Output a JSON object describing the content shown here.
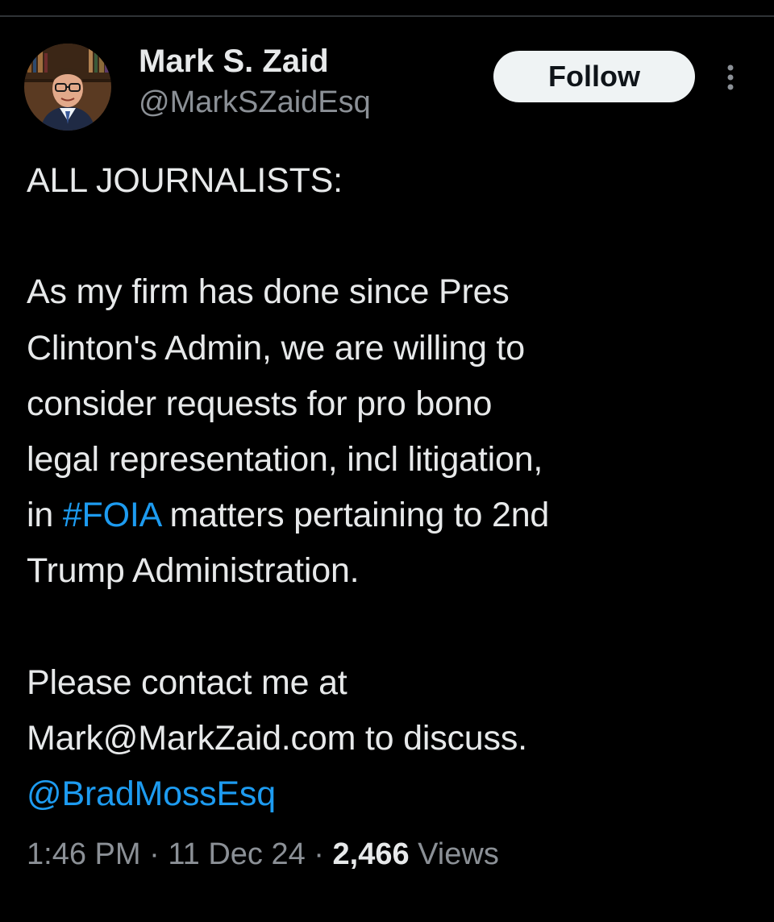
{
  "author": {
    "display_name": "Mark S. Zaid",
    "handle": "@MarkSZaidEsq"
  },
  "actions": {
    "follow_label": "Follow",
    "more_icon": "more-vertical-icon"
  },
  "tweet": {
    "line_1": "ALL JOURNALISTS:",
    "line_2": "As my firm has done since Pres",
    "line_3": "Clinton's Admin, we are willing to",
    "line_4": "consider requests for pro bono",
    "line_5": "legal representation, incl litigation,",
    "line_6_prefix": "in ",
    "hashtag": "#FOIA",
    "line_6_suffix": " matters pertaining to 2nd",
    "line_7": "Trump Administration.",
    "line_8": "Please contact me at",
    "line_9": "Mark@MarkZaid.com to discuss.",
    "mention": "@BradMossEsq"
  },
  "meta": {
    "time": "1:46 PM",
    "separator_1": " · ",
    "date": "11 Dec 24",
    "separator_2": " · ",
    "views_count": "2,466",
    "views_label": " Views"
  },
  "colors": {
    "background": "#000000",
    "text": "#e7e9ea",
    "secondary": "#8b9096",
    "link": "#1d9bf0",
    "button_bg": "#eff3f4"
  }
}
